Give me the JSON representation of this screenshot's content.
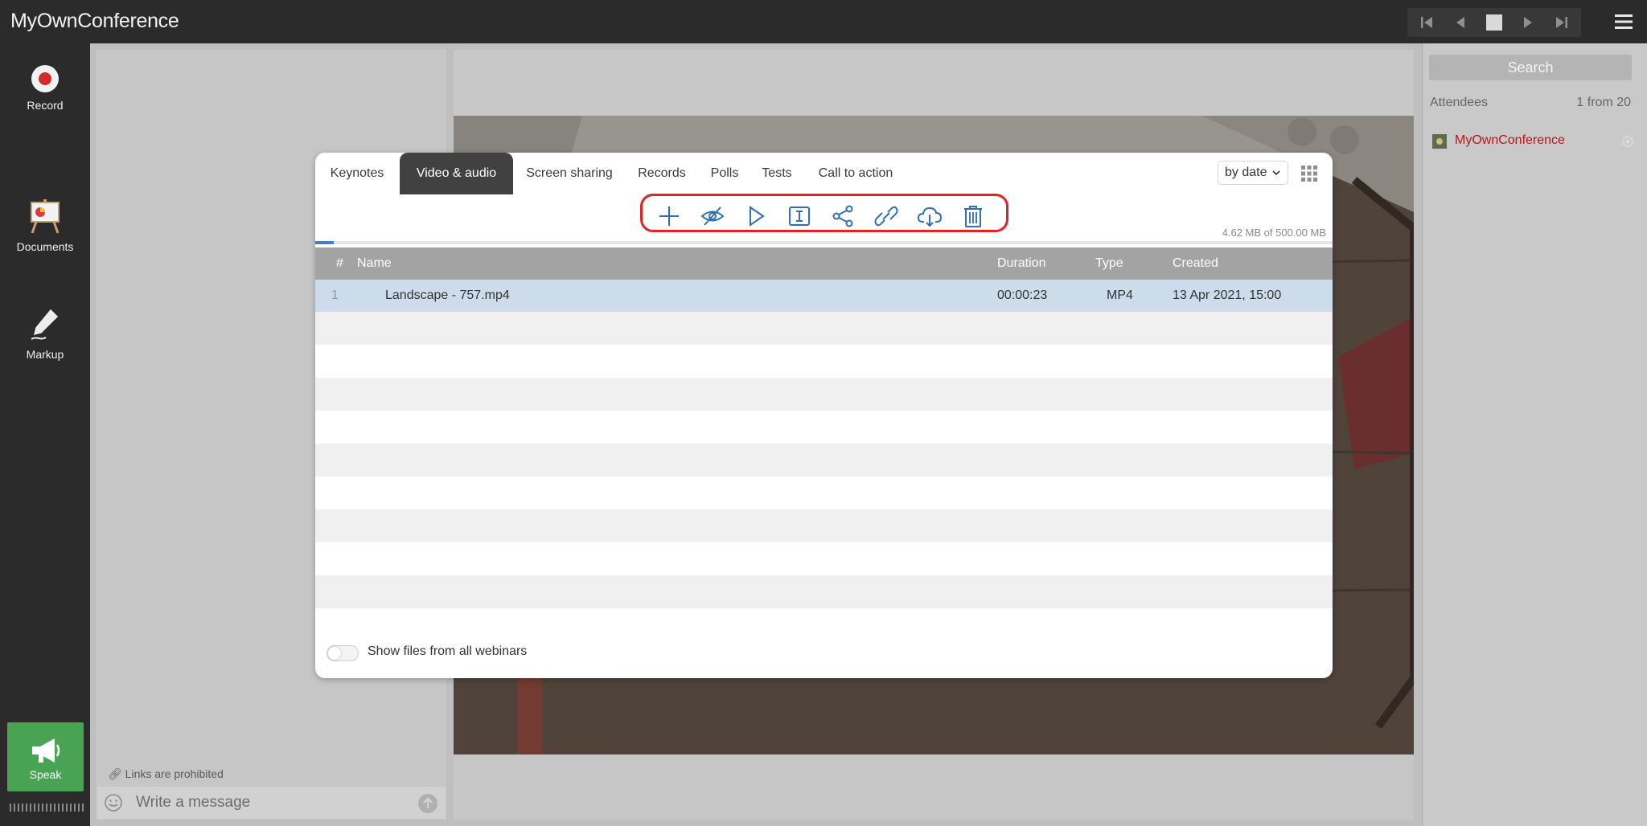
{
  "app": {
    "title": "MyOwnConference"
  },
  "left_nav": {
    "record_label": "Record",
    "documents_label": "Documents",
    "markup_label": "Markup",
    "speak_label": "Speak"
  },
  "chat": {
    "links_notice": "Links are prohibited",
    "message_placeholder": "Write a message"
  },
  "attendees": {
    "search_placeholder": "Search",
    "label": "Attendees",
    "count": "1 from 20",
    "items": [
      {
        "name": "MyOwnConference"
      }
    ]
  },
  "modal": {
    "tabs": [
      {
        "label": "Keynotes",
        "active": false
      },
      {
        "label": "Video & audio",
        "active": true
      },
      {
        "label": "Screen sharing",
        "active": false
      },
      {
        "label": "Records",
        "active": false
      },
      {
        "label": "Polls",
        "active": false
      },
      {
        "label": "Tests",
        "active": false
      },
      {
        "label": "Call to action",
        "active": false
      }
    ],
    "sort_value": "by date",
    "toolbar_icons": [
      "add-icon",
      "hide-icon",
      "play-icon",
      "rename-icon",
      "share-icon",
      "link-icon",
      "download-icon",
      "delete-icon"
    ],
    "storage_text": "4.62 MB of 500.00 MB",
    "storage_fraction": 0.0092,
    "table": {
      "headers": {
        "num": "#",
        "name": "Name",
        "duration": "Duration",
        "type": "Type",
        "created": "Created"
      },
      "rows": [
        {
          "num": "1",
          "name": "Landscape - 757.mp4",
          "duration": "00:00:23",
          "type": "MP4",
          "created": "13 Apr 2021, 15:00",
          "selected": true
        }
      ]
    },
    "show_all_label": "Show files from all webinars",
    "show_all_enabled": false
  },
  "colors": {
    "accent": "#2f6fb3",
    "highlight_ring": "#e02424",
    "speak_green": "#48a353",
    "attendee_name": "#b11a1a"
  }
}
